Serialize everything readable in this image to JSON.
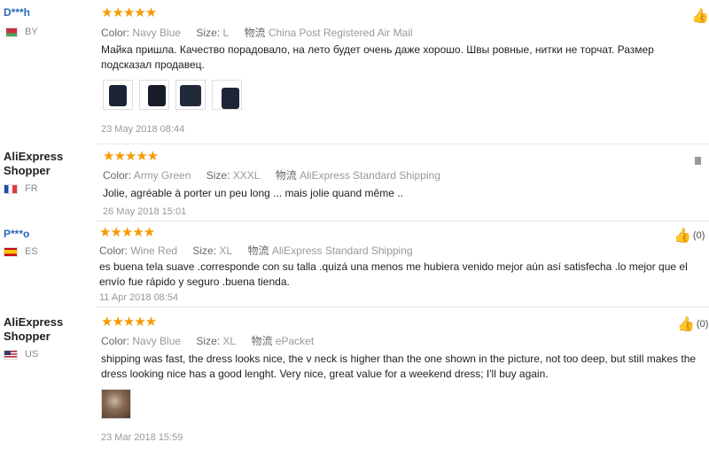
{
  "reviews": [
    {
      "user": "D***h",
      "country": "BY",
      "stars": "★★★★★",
      "color_label": "Color:",
      "color": "Navy Blue",
      "size_label": "Size:",
      "size": "L",
      "ship_label": "物流",
      "shipping": "China Post Registered Air Mail",
      "text": "Майка пришла. Качество порадовало, на лето будет очень даже хорошо. Швы ровные, нитки не торчат. Размер подсказал продавец.",
      "date": "23 May 2018 08:44"
    },
    {
      "user": "AliExpress Shopper",
      "country": "FR",
      "stars": "★★★★★",
      "color_label": "Color:",
      "color": "Army Green",
      "size_label": "Size:",
      "size": "XXXL",
      "ship_label": "物流",
      "shipping": "AliExpress Standard Shipping",
      "text": "Jolie, agréable à porter un peu long ... mais jolie quand même ..",
      "date": "26 May 2018 15:01"
    },
    {
      "user": "P***o",
      "country": "ES",
      "stars": "★★★★★",
      "color_label": "Color:",
      "color": "Wine Red",
      "size_label": "Size:",
      "size": "XL",
      "ship_label": "物流",
      "shipping": "AliExpress Standard Shipping",
      "text": "es buena tela suave .corresponde con su talla .quizá una menos me hubiera venido mejor aún así satisfecha .lo mejor que el envío fue rápido y seguro .buena tienda.",
      "date": "11 Apr 2018 08:54",
      "likes": "(0)"
    },
    {
      "user": "AliExpress Shopper",
      "country": "US",
      "stars": "★★★★★",
      "color_label": "Color:",
      "color": "Navy Blue",
      "size_label": "Size:",
      "size": "XL",
      "ship_label": "物流",
      "shipping": "ePacket",
      "text": "shipping was fast, the dress looks nice, the v neck is higher than the one shown in the picture, not too deep, but still makes the dress looking nice has a good lenght. Very nice, great value for a weekend dress; I'll buy again.",
      "date": "23 Mar 2018 15:59",
      "likes": "(0)"
    }
  ]
}
